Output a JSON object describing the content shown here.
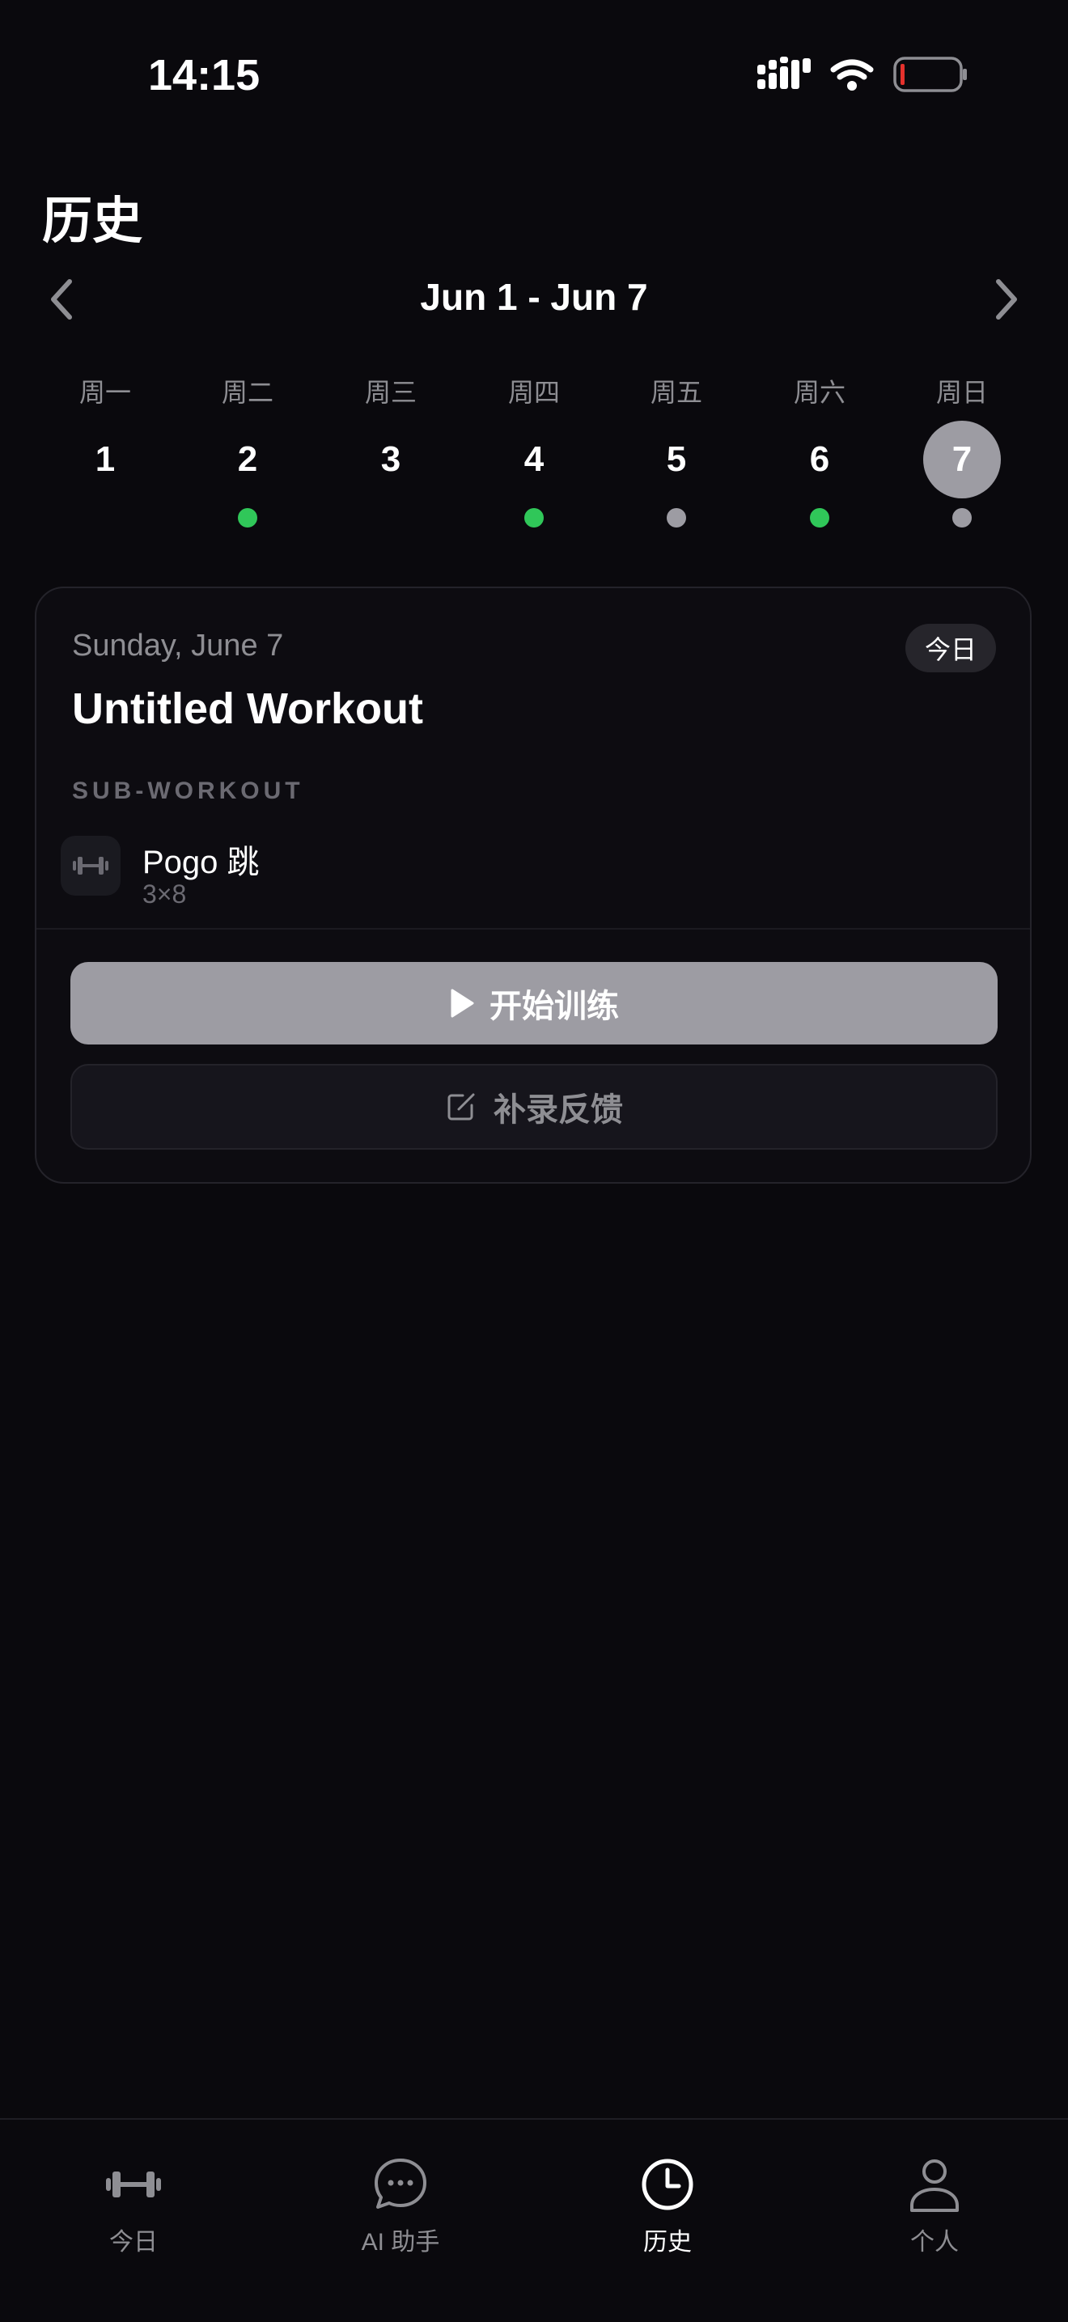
{
  "status_bar": {
    "time": "14:15"
  },
  "header": {
    "title": "历史"
  },
  "week": {
    "range": "Jun 1 - Jun 7",
    "days": [
      {
        "label": "周一",
        "num": "1",
        "dot": "none"
      },
      {
        "label": "周二",
        "num": "2",
        "dot": "green"
      },
      {
        "label": "周三",
        "num": "3",
        "dot": "none"
      },
      {
        "label": "周四",
        "num": "4",
        "dot": "green"
      },
      {
        "label": "周五",
        "num": "5",
        "dot": "gray"
      },
      {
        "label": "周六",
        "num": "6",
        "dot": "green"
      },
      {
        "label": "周日",
        "num": "7",
        "dot": "gray",
        "selected": true
      }
    ]
  },
  "card": {
    "date": "Sunday, June 7",
    "badge": "今日",
    "title": "Untitled Workout",
    "section_label": "SUB-WORKOUT",
    "exercise": {
      "name": "Pogo 跳",
      "meta": "3×8",
      "icon": "dumbbell-icon"
    },
    "start_label": "开始训练",
    "feedback_label": "补录反馈"
  },
  "tabs": [
    {
      "label": "今日",
      "icon": "dumbbell-icon",
      "active": false
    },
    {
      "label": "AI 助手",
      "icon": "chat-bubble-icon",
      "active": false
    },
    {
      "label": "历史",
      "icon": "clock-icon",
      "active": true
    },
    {
      "label": "个人",
      "icon": "person-icon",
      "active": false
    }
  ],
  "colors": {
    "background": "#0a090d",
    "dot_green": "#30c759",
    "dot_gray": "#9d9ca3",
    "muted_text": "#8e8e93",
    "battery_low": "#e5312c"
  }
}
